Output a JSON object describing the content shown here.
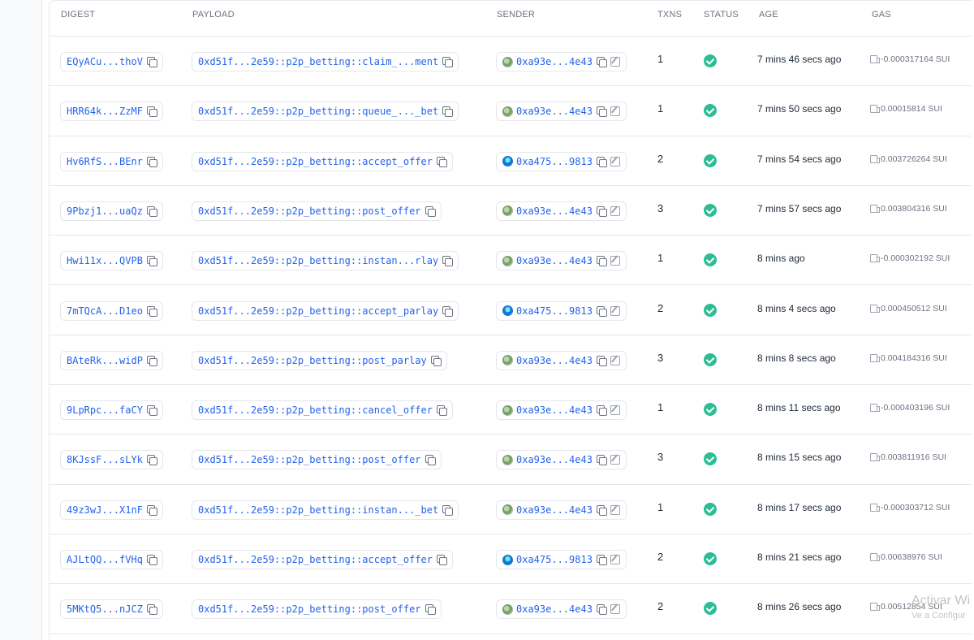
{
  "table": {
    "headers": {
      "digest": "DIGEST",
      "payload": "PAYLOAD",
      "sender": "SENDER",
      "txns": "TXNS",
      "status": "STATUS",
      "age": "AGE",
      "gas": "GAS"
    },
    "rows": [
      {
        "digest": "EQyACu...thoV",
        "payload": "0xd51f...2e59::p2p_betting::claim_...ment",
        "sender": "0xa93e...4e43",
        "avatar": "green",
        "txns": "1",
        "status": "success",
        "age": "7 mins 46 secs ago",
        "gas": "-0.000317164 SUI"
      },
      {
        "digest": "HRR64k...ZzMF",
        "payload": "0xd51f...2e59::p2p_betting::queue_..._bet",
        "sender": "0xa93e...4e43",
        "avatar": "green",
        "txns": "1",
        "status": "success",
        "age": "7 mins 50 secs ago",
        "gas": "0.00015814 SUI"
      },
      {
        "digest": "Hv6RfS...BEnr",
        "payload": "0xd51f...2e59::p2p_betting::accept_offer",
        "sender": "0xa475...9813",
        "avatar": "blue",
        "txns": "2",
        "status": "success",
        "age": "7 mins 54 secs ago",
        "gas": "0.003726264 SUI"
      },
      {
        "digest": "9Pbzj1...uaQz",
        "payload": "0xd51f...2e59::p2p_betting::post_offer",
        "sender": "0xa93e...4e43",
        "avatar": "green",
        "txns": "3",
        "status": "success",
        "age": "7 mins 57 secs ago",
        "gas": "0.003804316 SUI"
      },
      {
        "digest": "Hwi11x...QVPB",
        "payload": "0xd51f...2e59::p2p_betting::instan...rlay",
        "sender": "0xa93e...4e43",
        "avatar": "green",
        "txns": "1",
        "status": "success",
        "age": "8 mins ago",
        "gas": "-0.000302192 SUI"
      },
      {
        "digest": "7mTQcA...D1eo",
        "payload": "0xd51f...2e59::p2p_betting::accept_parlay",
        "sender": "0xa475...9813",
        "avatar": "blue",
        "txns": "2",
        "status": "success",
        "age": "8 mins 4 secs ago",
        "gas": "0.000450512 SUI"
      },
      {
        "digest": "BAteRk...widP",
        "payload": "0xd51f...2e59::p2p_betting::post_parlay",
        "sender": "0xa93e...4e43",
        "avatar": "green",
        "txns": "3",
        "status": "success",
        "age": "8 mins 8 secs ago",
        "gas": "0.004184316 SUI"
      },
      {
        "digest": "9LpRpc...faCY",
        "payload": "0xd51f...2e59::p2p_betting::cancel_offer",
        "sender": "0xa93e...4e43",
        "avatar": "green",
        "txns": "1",
        "status": "success",
        "age": "8 mins 11 secs ago",
        "gas": "-0.000403196 SUI"
      },
      {
        "digest": "8KJssF...sLYk",
        "payload": "0xd51f...2e59::p2p_betting::post_offer",
        "sender": "0xa93e...4e43",
        "avatar": "green",
        "txns": "3",
        "status": "success",
        "age": "8 mins 15 secs ago",
        "gas": "0.003811916 SUI"
      },
      {
        "digest": "49z3wJ...X1nF",
        "payload": "0xd51f...2e59::p2p_betting::instan..._bet",
        "sender": "0xa93e...4e43",
        "avatar": "green",
        "txns": "1",
        "status": "success",
        "age": "8 mins 17 secs ago",
        "gas": "-0.000303712 SUI"
      },
      {
        "digest": "AJLtQQ...fVHq",
        "payload": "0xd51f...2e59::p2p_betting::accept_offer",
        "sender": "0xa475...9813",
        "avatar": "blue",
        "txns": "2",
        "status": "success",
        "age": "8 mins 21 secs ago",
        "gas": "0.00638976 SUI"
      },
      {
        "digest": "5MKtQ5...nJCZ",
        "payload": "0xd51f...2e59::p2p_betting::post_offer",
        "sender": "0xa93e...4e43",
        "avatar": "green",
        "txns": "2",
        "status": "success",
        "age": "8 mins 26 secs ago",
        "gas": "0.00512854 SUI"
      }
    ]
  },
  "watermark": {
    "title": "Activar Wi",
    "subtitle": "Ve a Configur"
  },
  "colors": {
    "link": "#2563eb",
    "success": "#2dbd95",
    "border": "#e5e7eb",
    "muted": "#6b7280"
  }
}
